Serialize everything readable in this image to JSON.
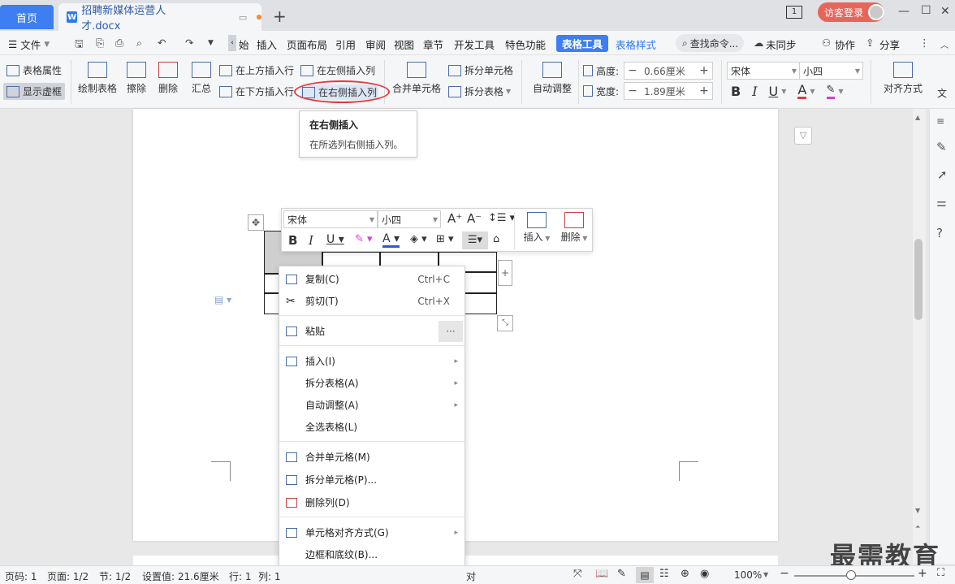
{
  "titlebar": {
    "home_tab": "首页",
    "doc_icon": "W",
    "doc_title": "招聘新媒体运营人才.docx",
    "new_tab": "+",
    "page_indicator": "1",
    "login_label": "访客登录",
    "window_min": "—",
    "window_max": "☐",
    "window_close": "✕"
  },
  "menubar": {
    "file": "文件",
    "items": [
      "始",
      "插入",
      "页面布局",
      "引用",
      "审阅",
      "视图",
      "章节",
      "开发工具",
      "特色功能"
    ],
    "active_tab": "表格工具",
    "style_tab": "表格样式",
    "search_placeholder": "查找命令...",
    "sync": "未同步",
    "collab": "协作",
    "share": "分享"
  },
  "ribbon": {
    "table_props": "表格属性",
    "show_grid": "显示虚框",
    "draw_table": "绘制表格",
    "erase": "擦除",
    "delete": "删除",
    "summary": "汇总",
    "insert_above": "在上方插入行",
    "insert_below": "在下方插入行",
    "insert_left": "在左侧插入列",
    "insert_right": "在右侧插入列",
    "merge_cells": "合并单元格",
    "split_cells": "拆分单元格",
    "split_table": "拆分表格",
    "auto_fit": "自动调整",
    "height_label": "高度:",
    "height_value": "0.66厘米",
    "width_label": "宽度:",
    "width_value": "1.89厘米",
    "font_name": "宋体",
    "font_size": "小四",
    "align": "对齐方式",
    "text_dir": "文"
  },
  "tooltip": {
    "title": "在右侧插入",
    "desc": "在所选列右侧插入列。"
  },
  "mini_toolbar": {
    "font": "宋体",
    "size": "小四",
    "insert": "插入",
    "delete": "删除"
  },
  "context_menu": {
    "items": [
      {
        "label": "复制(C)",
        "shortcut": "Ctrl+C"
      },
      {
        "label": "剪切(T)",
        "shortcut": "Ctrl+X"
      },
      {
        "label": "粘贴",
        "shortcut": "···"
      },
      {
        "label": "插入(I)"
      },
      {
        "label": "拆分表格(A)"
      },
      {
        "label": "自动调整(A)"
      },
      {
        "label": "全选表格(L)"
      },
      {
        "label": "合并单元格(M)"
      },
      {
        "label": "拆分单元格(P)..."
      },
      {
        "label": "删除列(D)"
      },
      {
        "label": "单元格对齐方式(G)"
      },
      {
        "label": "边框和底纹(B)..."
      }
    ]
  },
  "statusbar": {
    "page_code": "页码: 1",
    "pages": "页面: 1/2",
    "section": "节: 1/2",
    "setting": "设置值: 21.6厘米",
    "row": "行: 1",
    "col": "列: 1",
    "partial": "对",
    "zoom": "100%"
  },
  "watermark": "最需教育",
  "colors": {
    "accent": "#3d7ef0",
    "login": "#e8655a",
    "highlight_circle": "#e53a3a"
  }
}
